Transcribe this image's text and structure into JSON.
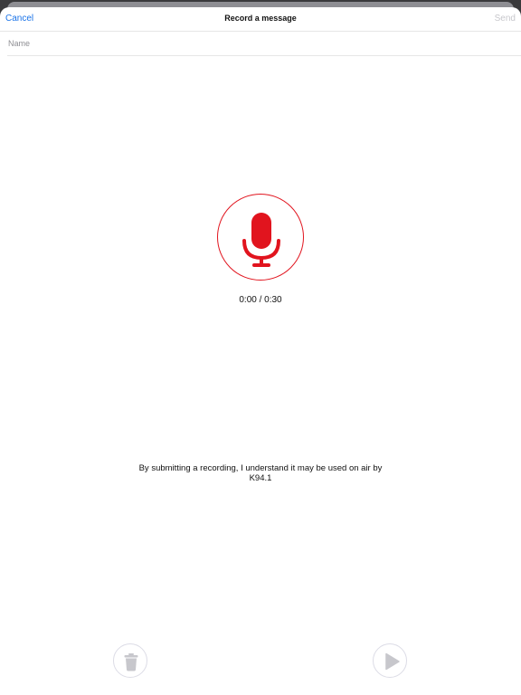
{
  "navbar": {
    "cancel_label": "Cancel",
    "title": "Record a message",
    "send_label": "Send"
  },
  "name_field": {
    "placeholder": "Name",
    "value": ""
  },
  "recorder": {
    "icon": "microphone-icon",
    "timer": "0:00 / 0:30",
    "accent_color": "#e1141e"
  },
  "disclaimer": "By submitting a recording, I understand it may be used on air by K94.1",
  "controls": {
    "delete_icon": "trash-icon",
    "play_icon": "play-icon",
    "disabled_color": "#c7c7cc"
  },
  "colors": {
    "link": "#1a73e8",
    "disabled_text": "#c7c7cc"
  }
}
